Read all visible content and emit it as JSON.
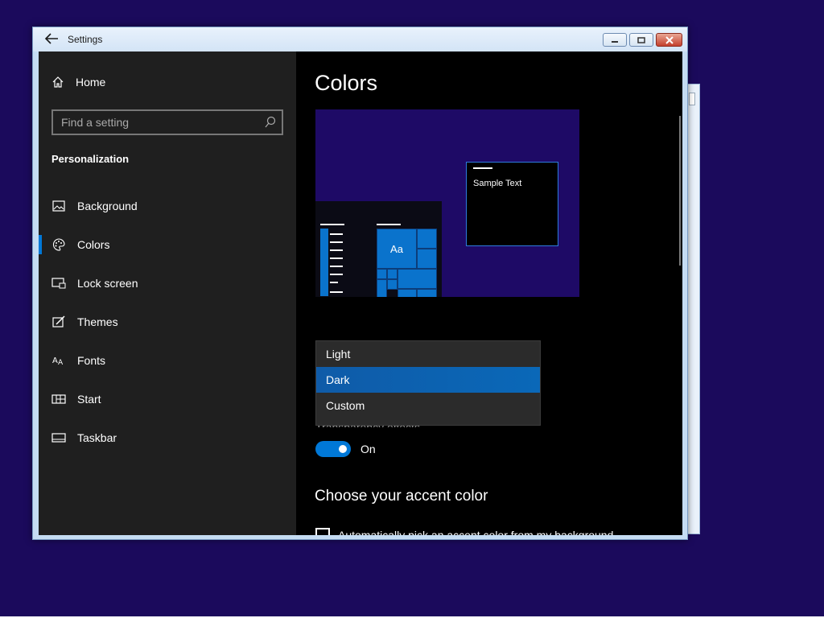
{
  "window": {
    "title": "Settings"
  },
  "sidebar": {
    "home_label": "Home",
    "search_placeholder": "Find a setting",
    "section_title": "Personalization",
    "items": [
      {
        "label": "Background",
        "icon": "picture-icon"
      },
      {
        "label": "Colors",
        "icon": "palette-icon",
        "active": true
      },
      {
        "label": "Lock screen",
        "icon": "lock-screen-icon"
      },
      {
        "label": "Themes",
        "icon": "themes-icon"
      },
      {
        "label": "Fonts",
        "icon": "fonts-icon"
      },
      {
        "label": "Start",
        "icon": "start-icon"
      },
      {
        "label": "Taskbar",
        "icon": "taskbar-icon"
      }
    ]
  },
  "main": {
    "title": "Colors",
    "preview": {
      "sample_text": "Sample Text",
      "tile_text": "Aa"
    },
    "color_dropdown": {
      "options": [
        "Light",
        "Dark",
        "Custom"
      ],
      "selected": "Dark"
    },
    "transparency": {
      "label": "Transparency effects",
      "state": "On",
      "enabled": true
    },
    "accent_title": "Choose your accent color",
    "auto_pick_label": "Automatically pick an accent color from my background"
  },
  "colors": {
    "accent": "#0078d7",
    "desktop": "#1b0a5c"
  }
}
